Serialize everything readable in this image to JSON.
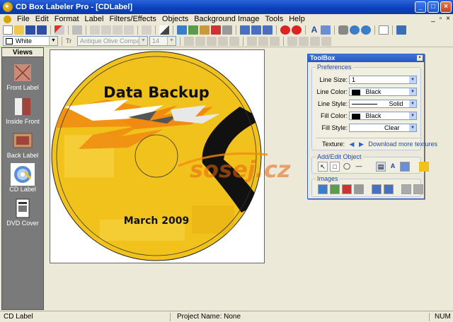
{
  "window": {
    "title": "CD Box Labeler Pro - [CDLabel]"
  },
  "menu": [
    "File",
    "Edit",
    "Format",
    "Label",
    "Filters/Effects",
    "Objects",
    "Background Image",
    "Tools",
    "Help"
  ],
  "format_bar": {
    "color_value": "White",
    "font_value": "Antique Olive Compact",
    "size_value": "14"
  },
  "views": {
    "header": "Views",
    "items": [
      {
        "label": "Front Label"
      },
      {
        "label": "Inside Front"
      },
      {
        "label": "Back Label"
      },
      {
        "label": "CD Label",
        "active": true
      },
      {
        "label": "DVD Cover"
      }
    ]
  },
  "label_design": {
    "title_text": "Data Backup",
    "date_text": "March 2009",
    "disc_color": "#f2c21c",
    "watermark": "sosej.cz"
  },
  "toolbox": {
    "title": "ToolBox",
    "preferences": {
      "header": "Preferences",
      "line_size": {
        "label": "Line Size:",
        "value": "1"
      },
      "line_color": {
        "label": "Line Color:",
        "value": "Black"
      },
      "line_style": {
        "label": "Line Style:",
        "value": "Solid"
      },
      "fill_color": {
        "label": "Fill Color:",
        "value": "Black"
      },
      "fill_style": {
        "label": "Fill Style:",
        "value": "Clear"
      },
      "texture": {
        "label": "Texture:",
        "link": "Download more textures"
      }
    },
    "add_edit": {
      "header": "Add/Edit Object"
    },
    "images": {
      "header": "Images"
    }
  },
  "status": {
    "left": "CD Label",
    "center": "Project Name: None",
    "right": "NUM"
  }
}
